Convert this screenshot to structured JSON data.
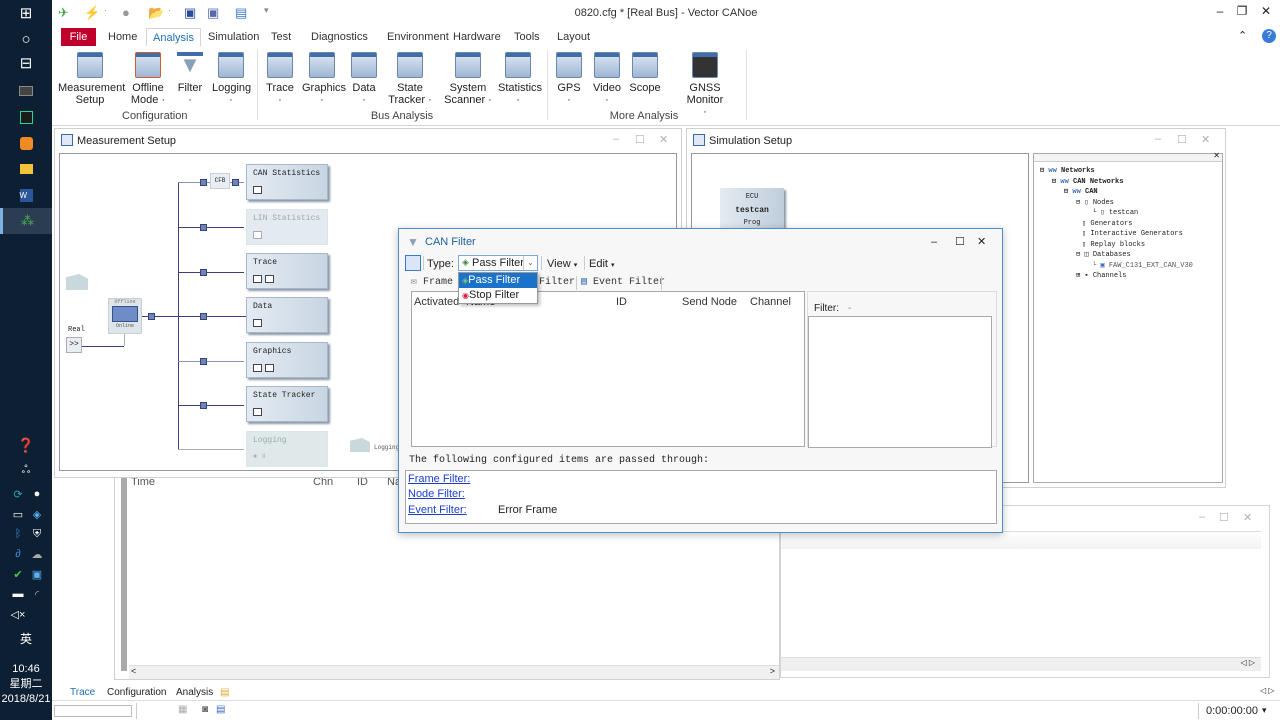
{
  "window": {
    "title": "0820.cfg * [Real Bus] - Vector CANoe",
    "minimize": "–",
    "restore": "❐",
    "close": "✕"
  },
  "quick_access": [
    "cursor-icon",
    "flash-icon",
    "record-icon",
    "open-icon",
    "save-icon",
    "save-all-icon",
    "network-icon"
  ],
  "menu_tabs": [
    {
      "label": "File"
    },
    {
      "label": "Home"
    },
    {
      "label": "Analysis",
      "active": true
    },
    {
      "label": "Simulation"
    },
    {
      "label": "Test"
    },
    {
      "label": "Diagnostics"
    },
    {
      "label": "Environment"
    },
    {
      "label": "Hardware"
    },
    {
      "label": "Tools"
    },
    {
      "label": "Layout"
    }
  ],
  "ribbon": {
    "configuration": {
      "label": "Configuration",
      "buttons": [
        {
          "line1": "Measurement",
          "line2": "Setup"
        },
        {
          "line1": "Offline",
          "line2": "Mode ·"
        },
        {
          "line1": "Filter",
          "line2": "·"
        },
        {
          "line1": "Logging",
          "line2": "·"
        }
      ]
    },
    "bus_analysis": {
      "label": "Bus Analysis",
      "buttons": [
        {
          "line1": "Trace",
          "line2": "·"
        },
        {
          "line1": "Graphics",
          "line2": "·"
        },
        {
          "line1": "Data",
          "line2": "·"
        },
        {
          "line1": "State",
          "line2": "Tracker ·"
        },
        {
          "line1": "System",
          "line2": "Scanner ·"
        },
        {
          "line1": "Statistics",
          "line2": "·"
        }
      ]
    },
    "more_analysis": {
      "label": "More Analysis",
      "buttons": [
        {
          "line1": "GPS",
          "line2": "·"
        },
        {
          "line1": "Video",
          "line2": "·"
        },
        {
          "line1": "Scope",
          "line2": ""
        },
        {
          "line1": "GNSS Monitor",
          "line2": "·"
        }
      ]
    }
  },
  "measurement_setup": {
    "title": "Measurement Setup",
    "source_label": "Real",
    "source_btn": ">>",
    "switch_offline": "Offline",
    "switch_online": "Online",
    "cfb": "CFB",
    "nodes": [
      {
        "label": "CAN Statistics"
      },
      {
        "label": "LIN Statistics",
        "disabled": true
      },
      {
        "label": "Trace"
      },
      {
        "label": "Data"
      },
      {
        "label": "Graphics"
      },
      {
        "label": "State Tracker"
      },
      {
        "label": "Logging",
        "disabled": true
      }
    ],
    "logging_target": "Logging"
  },
  "simulation_setup": {
    "title": "Simulation Setup",
    "ecu": {
      "line1": "ECU",
      "line2": "testcan",
      "line3": "Prog"
    },
    "tree": [
      {
        "label": "Networks",
        "level": 0,
        "bold": true,
        "expander": "−"
      },
      {
        "label": "CAN Networks",
        "level": 1,
        "bold": true,
        "expander": "−"
      },
      {
        "label": "CAN",
        "level": 2,
        "bold": true,
        "expander": "−"
      },
      {
        "label": "Nodes",
        "level": 3,
        "expander": "−"
      },
      {
        "label": "testcan",
        "level": 4
      },
      {
        "label": "Generators",
        "level": 3
      },
      {
        "label": "Interactive Generators",
        "level": 3
      },
      {
        "label": "Replay blocks",
        "level": 3
      },
      {
        "label": "Databases",
        "level": 3,
        "expander": "−"
      },
      {
        "label": "FAW_C131_EXT_CAN_V30",
        "level": 4
      },
      {
        "label": "Channels",
        "level": 3,
        "expander": "+"
      }
    ]
  },
  "trace_window": {
    "columns": [
      "Time",
      "Chn",
      "ID",
      "Name"
    ]
  },
  "can_filter": {
    "title": "CAN Filter",
    "type_label": "Type:",
    "type_value": "Pass Filter",
    "type_options": [
      "Pass Filter",
      "Stop Filter"
    ],
    "view_menu": "View",
    "edit_menu": "Edit",
    "tabs": [
      "Frame Filter",
      "Node Filter",
      "Event Filter"
    ],
    "columns": [
      "Activated",
      "Name",
      "ID",
      "Send Node",
      "Channel"
    ],
    "filter_label": "Filter:",
    "filter_value": "-",
    "summary_heading": "The following configured items are passed through:",
    "summary": [
      {
        "label": "Frame Filter:",
        "value": ""
      },
      {
        "label": "Node Filter:",
        "value": ""
      },
      {
        "label": "Event Filter:",
        "value": "Error Frame"
      }
    ]
  },
  "bottom_tabs": [
    "Trace",
    "Configuration",
    "Analysis"
  ],
  "status_bar": {
    "time": "0:00:00:00"
  },
  "taskbar": {
    "time": "10:46",
    "weekday": "星期二",
    "date": "2018/8/21",
    "ime": "英"
  }
}
